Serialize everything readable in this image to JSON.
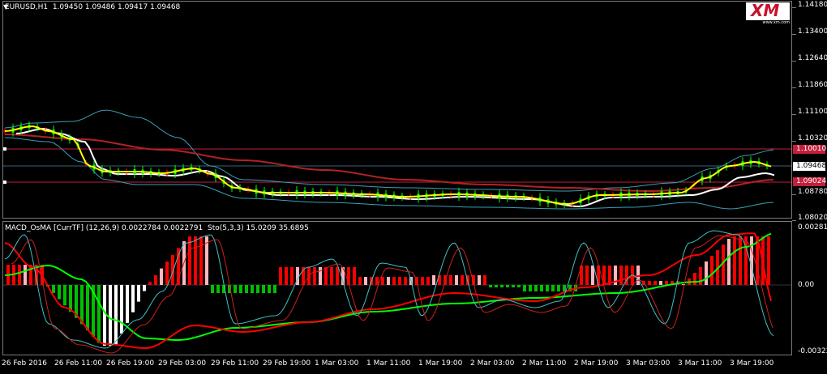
{
  "main_title": "EURUSD,H1  1.09450 1.09486 1.09417 1.09468",
  "sub_title": "MACD_OsMA [CurrTF] (12,26,9) 0.0022784 0.0022791  Sto(5,3,3) 15.0209 35.6895",
  "price_axis": [
    "1.14180",
    "1.13400",
    "1.12640",
    "1.11860",
    "1.11100",
    "1.10320",
    "1.09468",
    "1.08780",
    "1.08020"
  ],
  "hline_upper_tag": "1.10010",
  "hline_lower_tag": "1.09024",
  "current_price_tag": "1.09468",
  "sub_axis": [
    "0.002815",
    "0.00",
    "-0.003222"
  ],
  "time_axis": [
    "26 Feb 2016",
    "26 Feb 11:00",
    "26 Feb 19:00",
    "29 Feb 03:00",
    "29 Feb 11:00",
    "29 Feb 19:00",
    "1 Mar 03:00",
    "1 Mar 11:00",
    "1 Mar 19:00",
    "2 Mar 03:00",
    "2 Mar 11:00",
    "2 Mar 19:00",
    "3 Mar 03:00",
    "3 Mar 11:00",
    "3 Mar 19:00"
  ],
  "logo": {
    "text": "XM",
    "sub": "www.xm.com"
  },
  "colors": {
    "bull": "#00ff00",
    "bear": "#ff0000",
    "ema_fast": "#ffff00",
    "ema_mid": "#ffffff",
    "ma_slow": "#b22222",
    "bollinger": "#3aa0b8",
    "hline": "#c41e3a",
    "macd_green": "#00c000",
    "stoch_main": "#ff0000",
    "stoch_signal": "#40c0c0",
    "macd_signal": "#00ff00"
  }
}
